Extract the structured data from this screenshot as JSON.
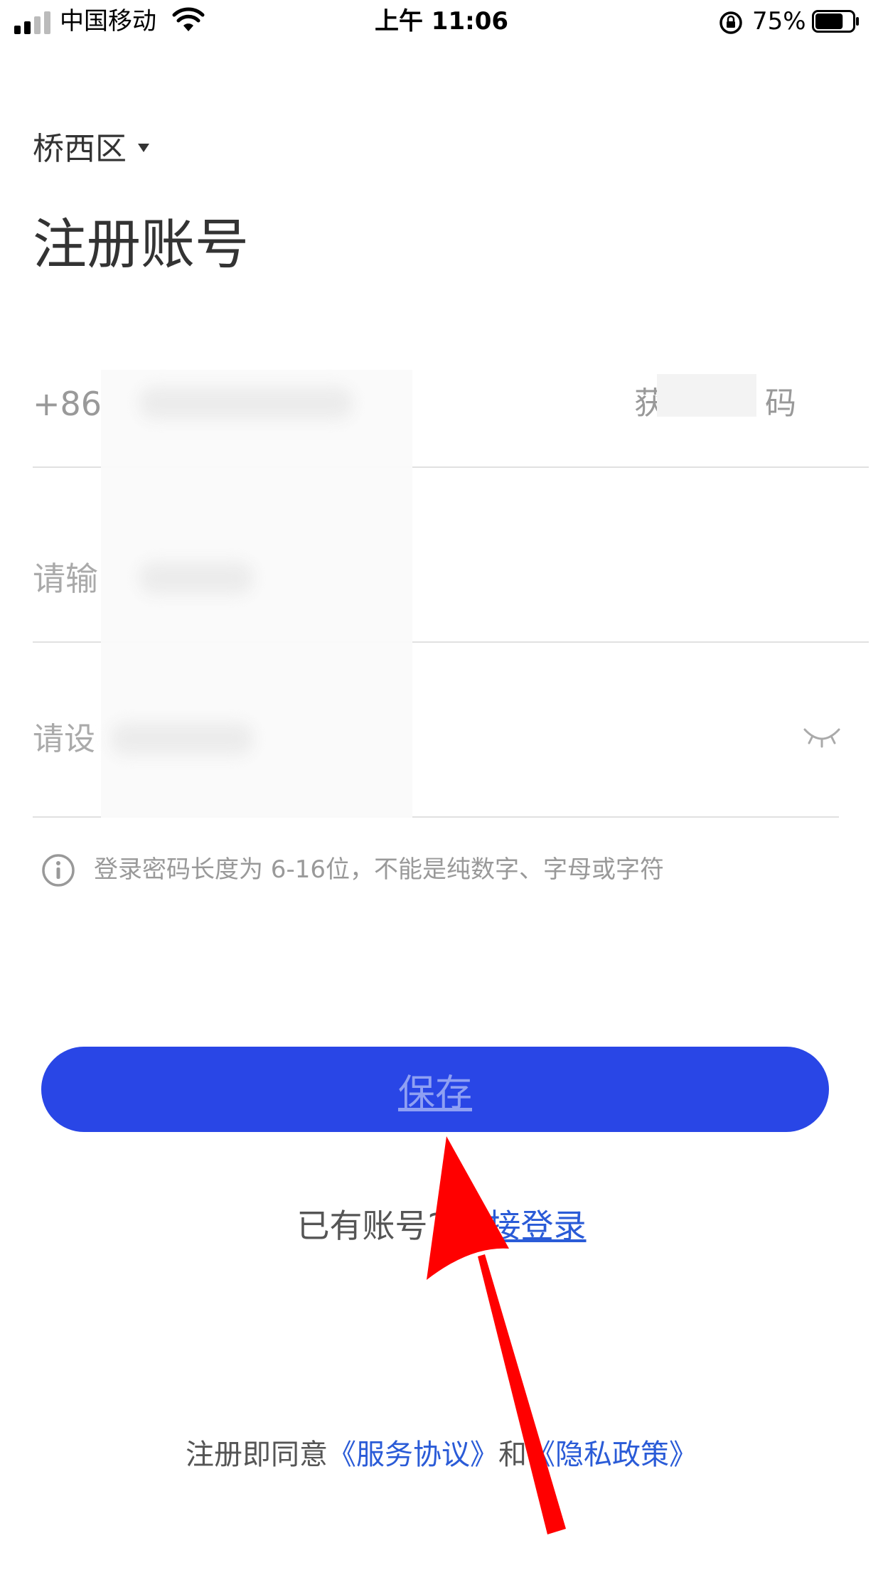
{
  "status_bar": {
    "carrier": "中国移动",
    "time": "上午 11:06",
    "battery_percent": "75%",
    "battery_level": 0.75,
    "signal_icon": "signal-bars-icon",
    "wifi_icon": "wifi-icon",
    "rotation_lock_icon": "rotation-lock-icon",
    "battery_icon": "battery-icon"
  },
  "region": {
    "label": "桥西区",
    "caret_icon": "caret-down-icon"
  },
  "page_title": "注册账号",
  "phone_field": {
    "prefix": "+86",
    "get_code_label_start": "获",
    "get_code_label_end": "码"
  },
  "code_field": {
    "placeholder_visible": "请输"
  },
  "password_field": {
    "placeholder_visible": "请设",
    "toggle_icon": "eye-closed-icon"
  },
  "hint": {
    "icon": "info-icon",
    "text": "登录密码长度为 6-16位，不能是纯数字、字母或字符"
  },
  "save_button": {
    "label": "保存",
    "color": "#2946e6"
  },
  "login_prompt": {
    "text": "已有账号?",
    "link": "直接登录"
  },
  "footer": {
    "prefix": "注册即同意",
    "service_link": "《服务协议》",
    "conjunction": "和",
    "privacy_link": "《隐私政策》"
  },
  "colors": {
    "accent": "#2946e6",
    "link": "#2a5bd7",
    "annotation_arrow": "#ff0000"
  }
}
